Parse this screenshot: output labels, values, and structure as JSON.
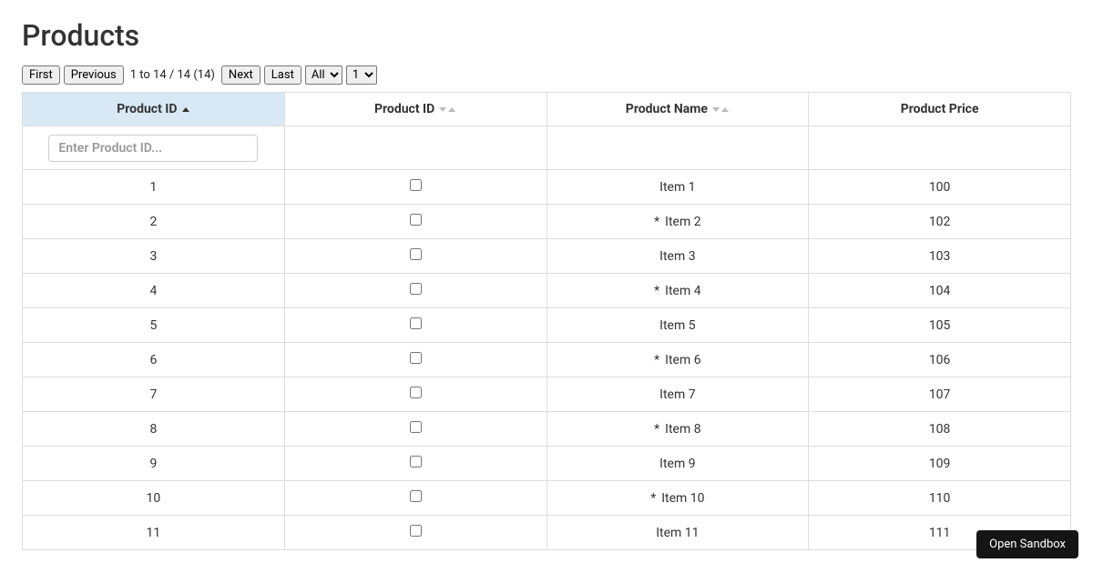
{
  "page_title": "Products",
  "toolbar": {
    "first_label": "First",
    "previous_label": "Previous",
    "page_info": "1 to 14 / 14 (14)",
    "next_label": "Next",
    "last_label": "Last",
    "page_size_options": [
      "All"
    ],
    "page_size_selected": "All",
    "page_number_options": [
      "1"
    ],
    "page_number_selected": "1"
  },
  "columns": [
    {
      "key": "id",
      "label": "Product ID",
      "sorted": "asc",
      "filter_placeholder": "Enter Product ID..."
    },
    {
      "key": "check",
      "label": "Product ID",
      "sorted": null
    },
    {
      "key": "name",
      "label": "Product Name",
      "sorted": null
    },
    {
      "key": "price",
      "label": "Product Price",
      "sorted": null
    }
  ],
  "rows": [
    {
      "id": "1",
      "checked": false,
      "starred": false,
      "name": "Item 1",
      "price": "100"
    },
    {
      "id": "2",
      "checked": false,
      "starred": true,
      "name": "Item 2",
      "price": "102"
    },
    {
      "id": "3",
      "checked": false,
      "starred": false,
      "name": "Item 3",
      "price": "103"
    },
    {
      "id": "4",
      "checked": false,
      "starred": true,
      "name": "Item 4",
      "price": "104"
    },
    {
      "id": "5",
      "checked": false,
      "starred": false,
      "name": "Item 5",
      "price": "105"
    },
    {
      "id": "6",
      "checked": false,
      "starred": true,
      "name": "Item 6",
      "price": "106"
    },
    {
      "id": "7",
      "checked": false,
      "starred": false,
      "name": "Item 7",
      "price": "107"
    },
    {
      "id": "8",
      "checked": false,
      "starred": true,
      "name": "Item 8",
      "price": "108"
    },
    {
      "id": "9",
      "checked": false,
      "starred": false,
      "name": "Item 9",
      "price": "109"
    },
    {
      "id": "10",
      "checked": false,
      "starred": true,
      "name": "Item 10",
      "price": "110"
    },
    {
      "id": "11",
      "checked": false,
      "starred": false,
      "name": "Item 11",
      "price": "111"
    }
  ],
  "footer": {
    "open_sandbox_label": "Open Sandbox"
  }
}
